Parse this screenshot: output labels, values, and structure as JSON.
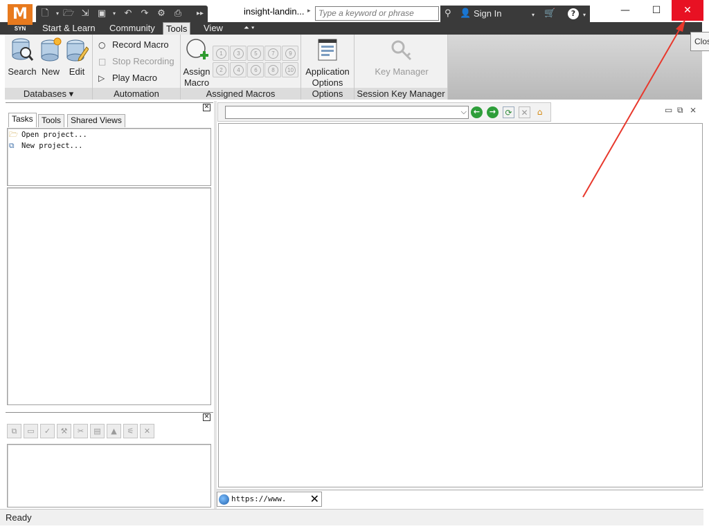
{
  "app": {
    "logo_letter": "M",
    "logo_sub": "SYN",
    "document_title": "insight-landin...",
    "search_placeholder": "Type a keyword or phrase",
    "sign_in": "Sign In"
  },
  "window_controls": {
    "minimize": "—",
    "maximize": "☐",
    "close": "✕"
  },
  "tabs": [
    {
      "label": "Start & Learn"
    },
    {
      "label": "Community"
    },
    {
      "label": "Tools",
      "active": true
    },
    {
      "label": "View"
    }
  ],
  "ribbon": {
    "databases": {
      "title": "Databases ▾",
      "buttons": [
        {
          "label": "Search"
        },
        {
          "label": "New"
        },
        {
          "label": "Edit"
        }
      ]
    },
    "automation": {
      "title": "Automation",
      "items": [
        {
          "label": "Record Macro",
          "enabled": true
        },
        {
          "label": "Stop Recording",
          "enabled": false
        },
        {
          "label": "Play Macro",
          "enabled": true
        }
      ]
    },
    "assigned_macros": {
      "title": "Assigned Macros",
      "assign_label_1": "Assign",
      "assign_label_2": "Macro",
      "slots": [
        "1",
        "3",
        "5",
        "7",
        "9",
        "2",
        "4",
        "6",
        "8",
        "10"
      ]
    },
    "options": {
      "title": "Options",
      "label_1": "Application",
      "label_2": "Options"
    },
    "session_key_manager": {
      "title": "Session Key Manager",
      "label": "Key Manager"
    }
  },
  "left_pane": {
    "tabs": [
      {
        "label": "Tasks",
        "active": true
      },
      {
        "label": "Tools"
      },
      {
        "label": "Shared Views"
      }
    ],
    "tasks": [
      {
        "label": "Open project..."
      },
      {
        "label": "New project..."
      }
    ]
  },
  "browser": {
    "address_value": "",
    "doc_tab_label": "https://www. auto..."
  },
  "status_text": "Ready",
  "tooltip_text": "Close",
  "colors": {
    "accent_orange": "#e87a1e",
    "close_red": "#e81123",
    "dark_bar": "#3a3a3a",
    "annotation_arrow": "#e8382c"
  }
}
